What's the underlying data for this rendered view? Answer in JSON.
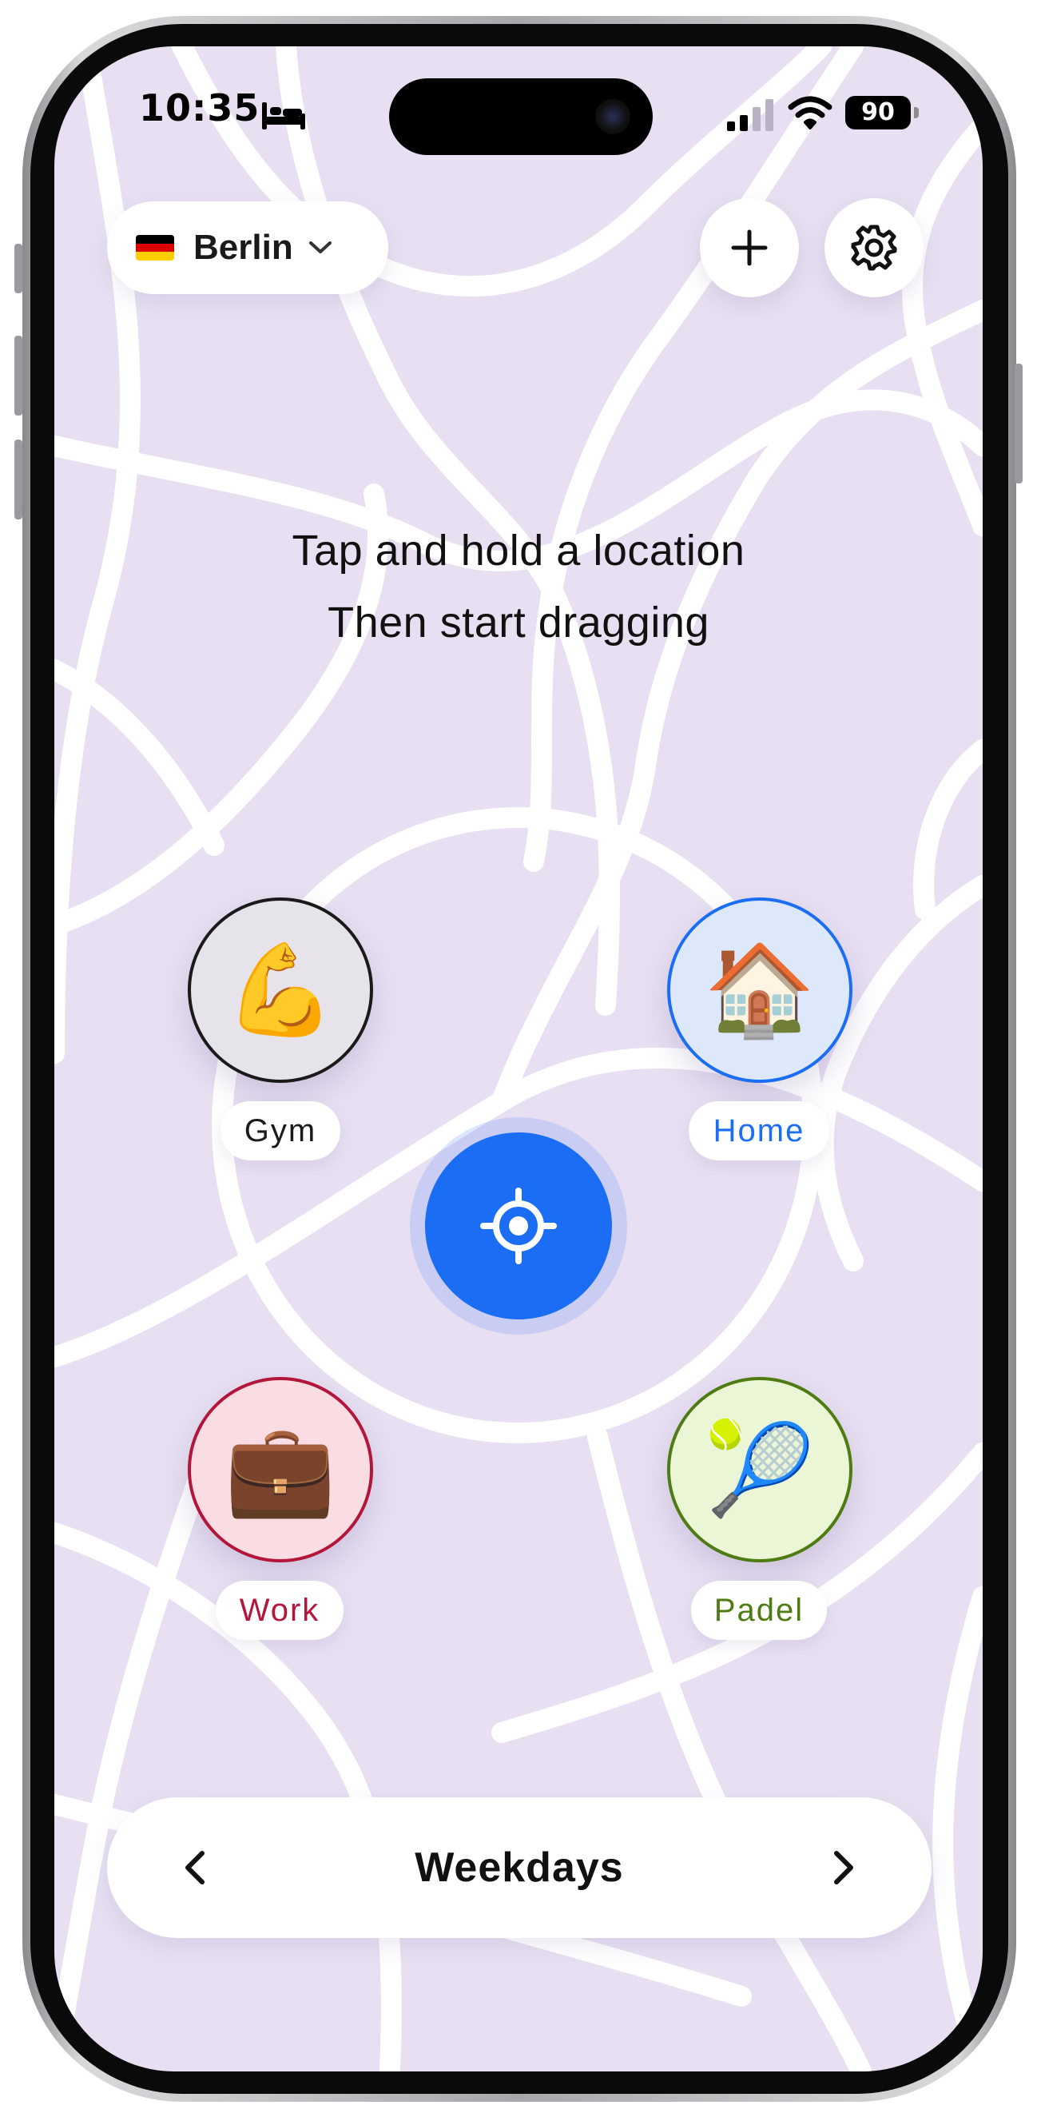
{
  "status_bar": {
    "time": "10:35",
    "battery": "90",
    "icons": [
      "bed-icon",
      "signal-icon",
      "wifi-icon",
      "battery-icon"
    ]
  },
  "header": {
    "city": "Berlin",
    "flag_icon": "germany-flag-icon",
    "add_icon": "plus-icon",
    "settings_icon": "gear-icon"
  },
  "hint": {
    "line1": "Tap and hold a location",
    "line2": "Then start dragging"
  },
  "locations": [
    {
      "label": "Gym",
      "emoji": "💪",
      "color": "#1a1a1a",
      "fill": "#e6e4ea"
    },
    {
      "label": "Home",
      "emoji": "🏠",
      "color": "#1b6ef3",
      "fill": "#dde9fb"
    },
    {
      "label": "Work",
      "emoji": "💼",
      "color": "#b3163a",
      "fill": "#f9dde3"
    },
    {
      "label": "Padel",
      "emoji": "🎾",
      "color": "#4e7b12",
      "fill": "#eaf6d6"
    }
  ],
  "center_button": {
    "icon": "crosshair-icon",
    "color": "#1b6ef3"
  },
  "day_selector": {
    "label": "Weekdays",
    "prev_icon": "chevron-left-icon",
    "next_icon": "chevron-right-icon"
  },
  "colors": {
    "map_background": "#e8e0f2",
    "roads": "#ffffff",
    "accent": "#1b6ef3"
  }
}
